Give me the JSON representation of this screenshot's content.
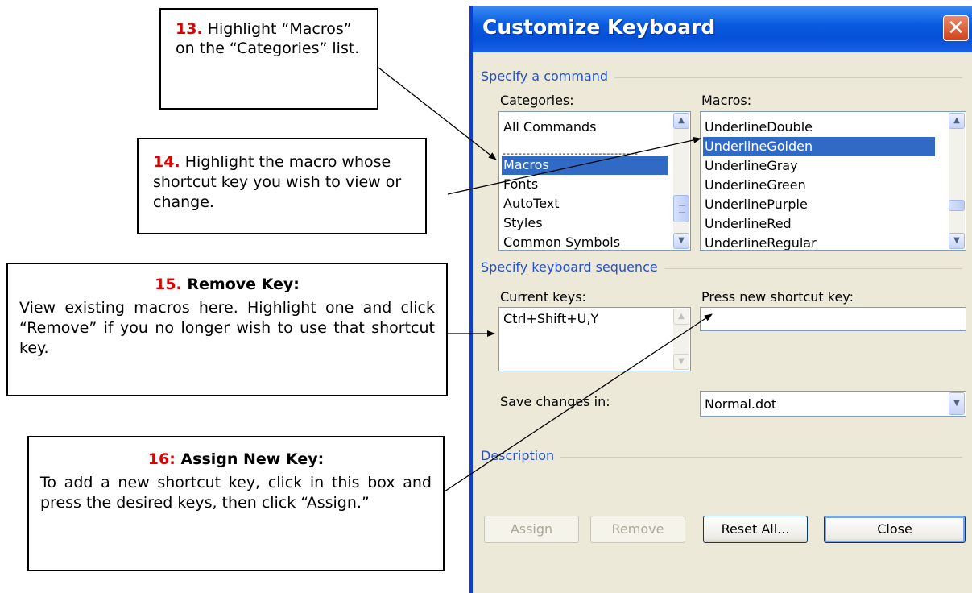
{
  "callouts": {
    "step13": {
      "number": "13.",
      "text": "Highlight “Macros” on the “Categories” list."
    },
    "step14": {
      "number": "14.",
      "text": "Highlight the macro whose shortcut key you wish to view or change."
    },
    "step15": {
      "number": "15.",
      "title": "Remove Key:",
      "text": "View existing macros here. Highlight one and click “Remove” if you no longer wish to use that shortcut key."
    },
    "step16": {
      "number": "16:",
      "title": "Assign New Key:",
      "text": "To add a new shortcut key, click in this box and press the desired keys, then click “Assign.”"
    }
  },
  "dialog": {
    "title": "Customize Keyboard",
    "close_glyph": "✕",
    "specify_command_label": "Specify a command",
    "categories_label": "Categories:",
    "categories": [
      "All Commands",
      "Macros",
      "Fonts",
      "AutoText",
      "Styles",
      "Common Symbols"
    ],
    "separator": "----------------------------------",
    "selected_category": "Macros",
    "macros_label": "Macros:",
    "macros": [
      "UnderlineDouble",
      "UnderlineGolden",
      "UnderlineGray",
      "UnderlineGreen",
      "UnderlinePurple",
      "UnderlineRed",
      "UnderlineRegular"
    ],
    "selected_macro": "UnderlineGolden",
    "keyboard_sequence_label": "Specify keyboard sequence",
    "current_keys_label": "Current keys:",
    "current_keys": [
      "Ctrl+Shift+U,Y"
    ],
    "new_shortcut_label": "Press new shortcut key:",
    "new_shortcut_value": "",
    "save_changes_label": "Save changes in:",
    "save_changes_value": "Normal.dot",
    "description_label": "Description",
    "buttons": {
      "assign": "Assign",
      "remove": "Remove",
      "reset_all": "Reset All...",
      "close": "Close"
    }
  },
  "colors": {
    "step_number": "#e00000",
    "title_bar": "#0550d8",
    "selection": "#316ac5",
    "group_label": "#2250d0",
    "dialog_bg": "#ece9d8"
  },
  "icons": [
    "close-icon",
    "scroll-up-icon",
    "scroll-down-icon",
    "dropdown-arrow-icon"
  ]
}
